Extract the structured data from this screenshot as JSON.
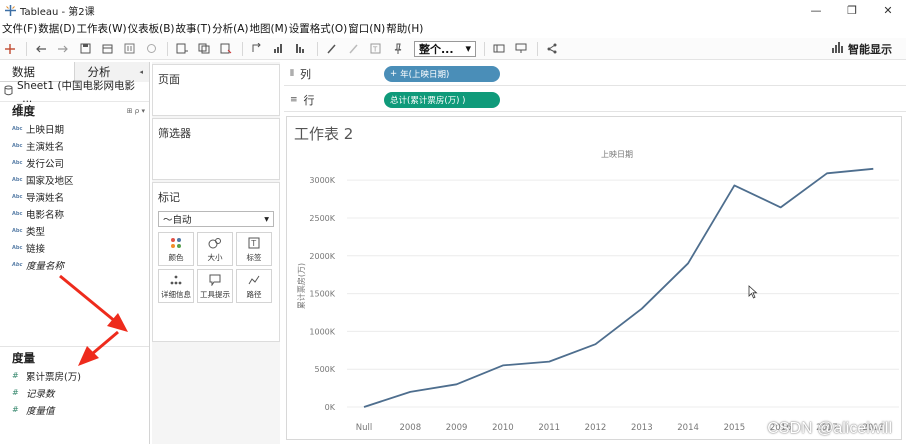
{
  "window": {
    "title": "Tableau - 第2课",
    "controls": {
      "minimize": "—",
      "maximize": "❐",
      "close": "✕"
    }
  },
  "menu": [
    "文件(F)",
    "数据(D)",
    "工作表(W)",
    "仪表板(B)",
    "故事(T)",
    "分析(A)",
    "地图(M)",
    "设置格式(O)",
    "窗口(N)",
    "帮助(H)"
  ],
  "toolbar": {
    "fit_select": "整个...",
    "show_me": "智能显示"
  },
  "data_pane": {
    "tabs": [
      "数据",
      "分析"
    ],
    "datasource": "Sheet1 (中国电影网电影_...",
    "dimensions_title": "维度",
    "dimensions": [
      "上映日期",
      "主演姓名",
      "发行公司",
      "国家及地区",
      "导演姓名",
      "电影名称",
      "类型",
      "链接",
      "度量名称"
    ],
    "measures_title": "度量",
    "measures": [
      "累计票房(万)",
      "记录数",
      "度量值"
    ],
    "type_abbrev": "Abc"
  },
  "cards": {
    "pages": "页面",
    "filters": "筛选器",
    "marks": "标记",
    "mark_type": "自动",
    "mark_buttons": [
      "颜色",
      "大小",
      "标签",
      "详细信息",
      "工具提示",
      "路径"
    ]
  },
  "shelves": {
    "columns_label": "列",
    "rows_label": "行",
    "column_pill": "年(上映日期)",
    "row_pill": "总计(累计票房(万) )"
  },
  "sheet": {
    "title": "工作表 2"
  },
  "chart_data": {
    "type": "line",
    "title": "",
    "xlabel": "上映日期",
    "ylabel": "累计票房(万)",
    "categories": [
      "Null",
      "2008",
      "2009",
      "2010",
      "2011",
      "2012",
      "2013",
      "2014",
      "2015",
      "2016",
      "2017",
      "2018"
    ],
    "y_ticks": [
      "0K",
      "500K",
      "1000K",
      "1500K",
      "2000K",
      "2500K",
      "3000K"
    ],
    "ylim": [
      0,
      3200
    ],
    "values": [
      0,
      200,
      300,
      550,
      600,
      830,
      1300,
      1900,
      2930,
      2640,
      3090,
      3150
    ],
    "y_unit": "K",
    "line_color": "#4e6e8e",
    "grid": true
  },
  "watermark": "CSDN @aliceiwill",
  "colors": {
    "column_pill": "#4a8eb8",
    "row_pill": "#0f9a7a",
    "annotation_arrow": "#ee2b1c"
  }
}
